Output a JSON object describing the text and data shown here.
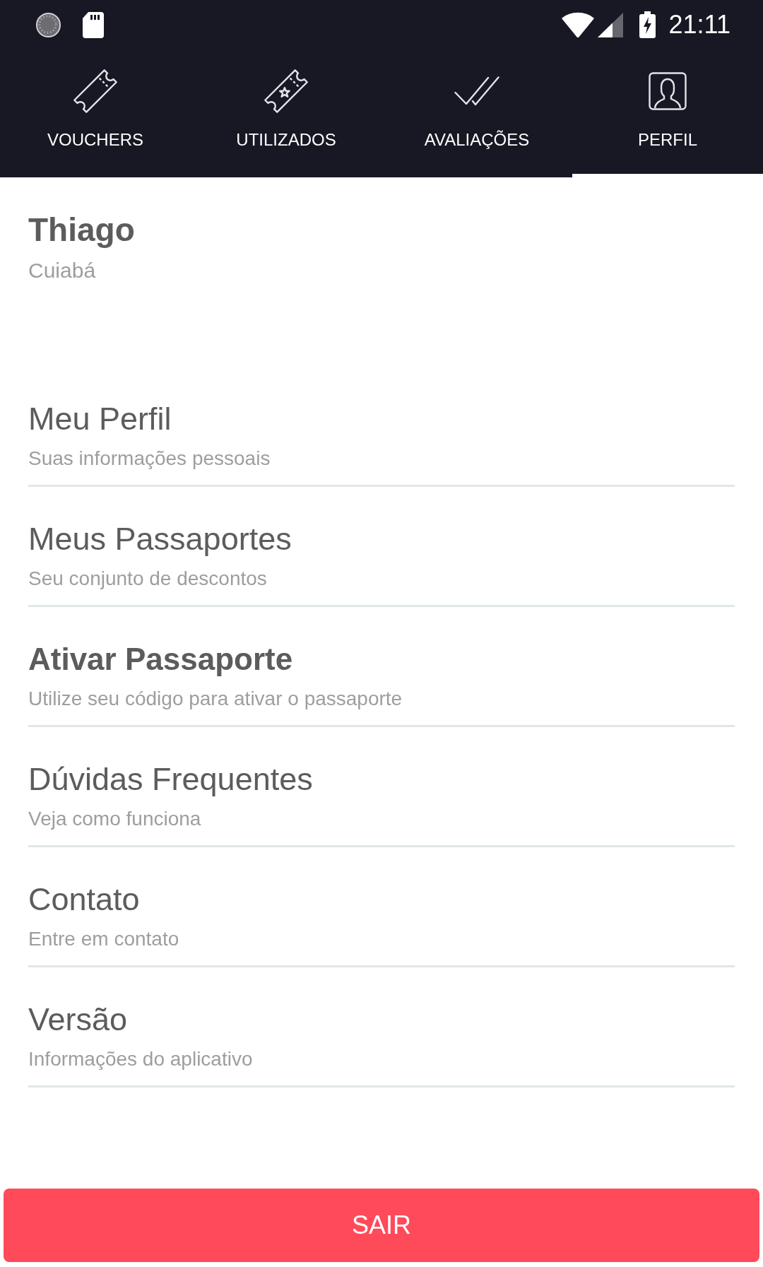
{
  "status_bar": {
    "time": "21:11"
  },
  "tabs": [
    {
      "label": "VOUCHERS",
      "kind": "ticket",
      "selected": false
    },
    {
      "label": "UTILIZADOS",
      "kind": "ticket_star",
      "selected": false
    },
    {
      "label": "AVALIAÇÕES",
      "kind": "double_check",
      "selected": false
    },
    {
      "label": "PERFIL",
      "kind": "profile",
      "selected": true
    }
  ],
  "profile": {
    "name": "Thiago",
    "city": "Cuiabá"
  },
  "menu": [
    {
      "title": "Meu Perfil",
      "subtitle": "Suas informações pessoais",
      "emphasized": false
    },
    {
      "title": "Meus Passaportes",
      "subtitle": "Seu conjunto de descontos",
      "emphasized": false
    },
    {
      "title": "Ativar Passaporte",
      "subtitle": "Utilize seu código para ativar o passaporte",
      "emphasized": true
    },
    {
      "title": "Dúvidas Frequentes",
      "subtitle": "Veja como funciona",
      "emphasized": false
    },
    {
      "title": "Contato",
      "subtitle": "Entre em contato",
      "emphasized": false
    },
    {
      "title": "Versão",
      "subtitle": "Informações do aplicativo",
      "emphasized": false
    }
  ],
  "logout_button": {
    "label": "SAIR"
  }
}
